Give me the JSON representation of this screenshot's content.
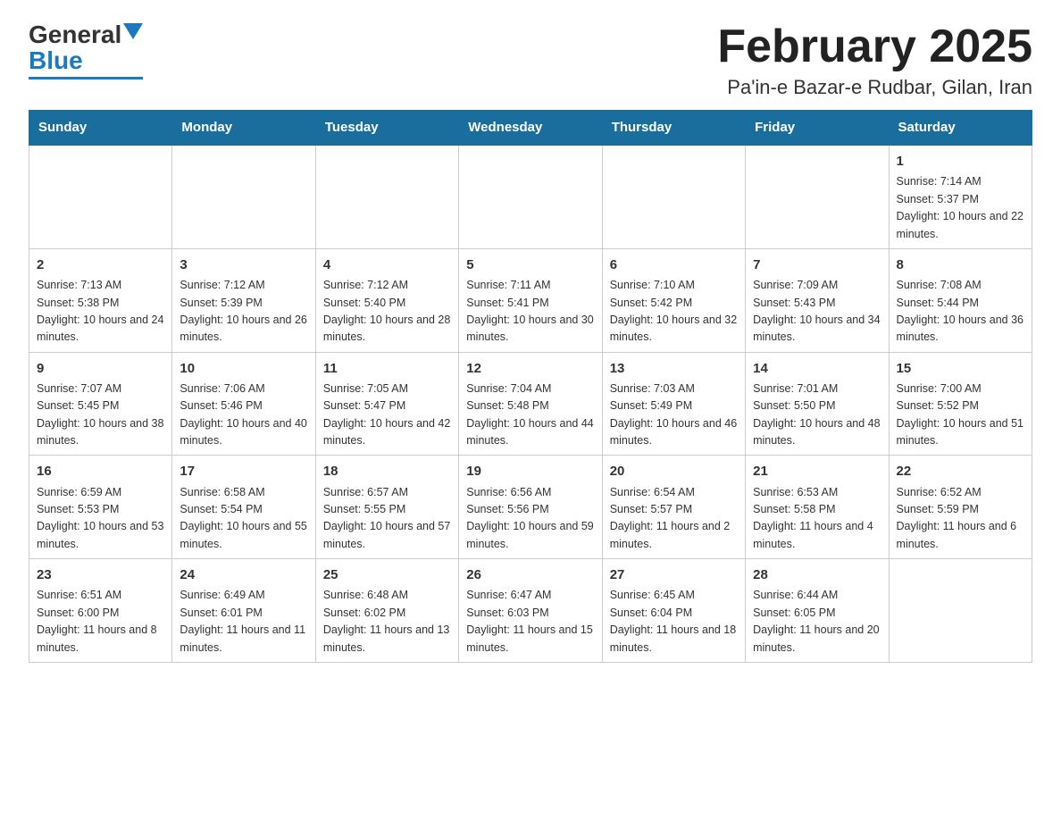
{
  "logo": {
    "text_general": "General",
    "text_blue": "Blue"
  },
  "title": "February 2025",
  "subtitle": "Pa'in-e Bazar-e Rudbar, Gilan, Iran",
  "headers": [
    "Sunday",
    "Monday",
    "Tuesday",
    "Wednesday",
    "Thursday",
    "Friday",
    "Saturday"
  ],
  "weeks": [
    [
      {
        "day": "",
        "info": ""
      },
      {
        "day": "",
        "info": ""
      },
      {
        "day": "",
        "info": ""
      },
      {
        "day": "",
        "info": ""
      },
      {
        "day": "",
        "info": ""
      },
      {
        "day": "",
        "info": ""
      },
      {
        "day": "1",
        "info": "Sunrise: 7:14 AM\nSunset: 5:37 PM\nDaylight: 10 hours and 22 minutes."
      }
    ],
    [
      {
        "day": "2",
        "info": "Sunrise: 7:13 AM\nSunset: 5:38 PM\nDaylight: 10 hours and 24 minutes."
      },
      {
        "day": "3",
        "info": "Sunrise: 7:12 AM\nSunset: 5:39 PM\nDaylight: 10 hours and 26 minutes."
      },
      {
        "day": "4",
        "info": "Sunrise: 7:12 AM\nSunset: 5:40 PM\nDaylight: 10 hours and 28 minutes."
      },
      {
        "day": "5",
        "info": "Sunrise: 7:11 AM\nSunset: 5:41 PM\nDaylight: 10 hours and 30 minutes."
      },
      {
        "day": "6",
        "info": "Sunrise: 7:10 AM\nSunset: 5:42 PM\nDaylight: 10 hours and 32 minutes."
      },
      {
        "day": "7",
        "info": "Sunrise: 7:09 AM\nSunset: 5:43 PM\nDaylight: 10 hours and 34 minutes."
      },
      {
        "day": "8",
        "info": "Sunrise: 7:08 AM\nSunset: 5:44 PM\nDaylight: 10 hours and 36 minutes."
      }
    ],
    [
      {
        "day": "9",
        "info": "Sunrise: 7:07 AM\nSunset: 5:45 PM\nDaylight: 10 hours and 38 minutes."
      },
      {
        "day": "10",
        "info": "Sunrise: 7:06 AM\nSunset: 5:46 PM\nDaylight: 10 hours and 40 minutes."
      },
      {
        "day": "11",
        "info": "Sunrise: 7:05 AM\nSunset: 5:47 PM\nDaylight: 10 hours and 42 minutes."
      },
      {
        "day": "12",
        "info": "Sunrise: 7:04 AM\nSunset: 5:48 PM\nDaylight: 10 hours and 44 minutes."
      },
      {
        "day": "13",
        "info": "Sunrise: 7:03 AM\nSunset: 5:49 PM\nDaylight: 10 hours and 46 minutes."
      },
      {
        "day": "14",
        "info": "Sunrise: 7:01 AM\nSunset: 5:50 PM\nDaylight: 10 hours and 48 minutes."
      },
      {
        "day": "15",
        "info": "Sunrise: 7:00 AM\nSunset: 5:52 PM\nDaylight: 10 hours and 51 minutes."
      }
    ],
    [
      {
        "day": "16",
        "info": "Sunrise: 6:59 AM\nSunset: 5:53 PM\nDaylight: 10 hours and 53 minutes."
      },
      {
        "day": "17",
        "info": "Sunrise: 6:58 AM\nSunset: 5:54 PM\nDaylight: 10 hours and 55 minutes."
      },
      {
        "day": "18",
        "info": "Sunrise: 6:57 AM\nSunset: 5:55 PM\nDaylight: 10 hours and 57 minutes."
      },
      {
        "day": "19",
        "info": "Sunrise: 6:56 AM\nSunset: 5:56 PM\nDaylight: 10 hours and 59 minutes."
      },
      {
        "day": "20",
        "info": "Sunrise: 6:54 AM\nSunset: 5:57 PM\nDaylight: 11 hours and 2 minutes."
      },
      {
        "day": "21",
        "info": "Sunrise: 6:53 AM\nSunset: 5:58 PM\nDaylight: 11 hours and 4 minutes."
      },
      {
        "day": "22",
        "info": "Sunrise: 6:52 AM\nSunset: 5:59 PM\nDaylight: 11 hours and 6 minutes."
      }
    ],
    [
      {
        "day": "23",
        "info": "Sunrise: 6:51 AM\nSunset: 6:00 PM\nDaylight: 11 hours and 8 minutes."
      },
      {
        "day": "24",
        "info": "Sunrise: 6:49 AM\nSunset: 6:01 PM\nDaylight: 11 hours and 11 minutes."
      },
      {
        "day": "25",
        "info": "Sunrise: 6:48 AM\nSunset: 6:02 PM\nDaylight: 11 hours and 13 minutes."
      },
      {
        "day": "26",
        "info": "Sunrise: 6:47 AM\nSunset: 6:03 PM\nDaylight: 11 hours and 15 minutes."
      },
      {
        "day": "27",
        "info": "Sunrise: 6:45 AM\nSunset: 6:04 PM\nDaylight: 11 hours and 18 minutes."
      },
      {
        "day": "28",
        "info": "Sunrise: 6:44 AM\nSunset: 6:05 PM\nDaylight: 11 hours and 20 minutes."
      },
      {
        "day": "",
        "info": ""
      }
    ]
  ]
}
